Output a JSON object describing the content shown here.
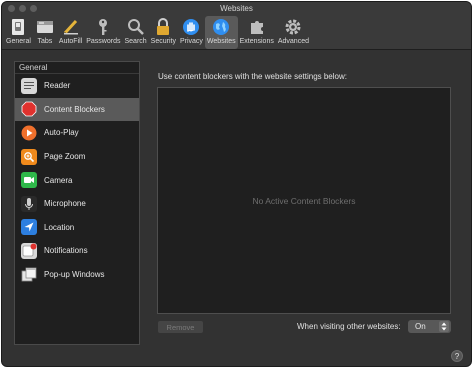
{
  "window": {
    "title": "Websites"
  },
  "toolbar": {
    "items": [
      {
        "label": "General",
        "icon": "general-switch-icon"
      },
      {
        "label": "Tabs",
        "icon": "tabs-icon"
      },
      {
        "label": "AutoFill",
        "icon": "autofill-pencil-icon"
      },
      {
        "label": "Passwords",
        "icon": "key-icon"
      },
      {
        "label": "Search",
        "icon": "magnifier-icon"
      },
      {
        "label": "Security",
        "icon": "lock-icon"
      },
      {
        "label": "Privacy",
        "icon": "hand-icon"
      },
      {
        "label": "Websites",
        "icon": "globe-icon",
        "selected": true
      },
      {
        "label": "Extensions",
        "icon": "puzzle-icon"
      },
      {
        "label": "Advanced",
        "icon": "gear-icon"
      }
    ]
  },
  "sidebar": {
    "header": "General",
    "items": [
      {
        "label": "Reader",
        "icon": "reader-icon"
      },
      {
        "label": "Content Blockers",
        "icon": "stop-sign-icon",
        "active": true
      },
      {
        "label": "Auto-Play",
        "icon": "play-icon"
      },
      {
        "label": "Page Zoom",
        "icon": "zoom-icon"
      },
      {
        "label": "Camera",
        "icon": "camera-icon"
      },
      {
        "label": "Microphone",
        "icon": "microphone-icon"
      },
      {
        "label": "Location",
        "icon": "location-arrow-icon"
      },
      {
        "label": "Notifications",
        "icon": "notifications-icon"
      },
      {
        "label": "Pop-up Windows",
        "icon": "popup-windows-icon"
      }
    ]
  },
  "main": {
    "heading": "Use content blockers with the website settings below:",
    "empty_message": "No Active Content Blockers",
    "remove_label": "Remove",
    "other_websites_label": "When visiting other websites:",
    "other_websites_value": "On",
    "help_label": "?"
  },
  "colors": {
    "window_bg": "#323232",
    "selected_bg": "#5a5a5a",
    "stop_red": "#e0322e",
    "play_orange": "#f0702c",
    "zoom_orange": "#f08a1c",
    "camera_green": "#2fb84a",
    "location_blue": "#2d7fe0",
    "globe_blue": "#2f8ef0"
  }
}
